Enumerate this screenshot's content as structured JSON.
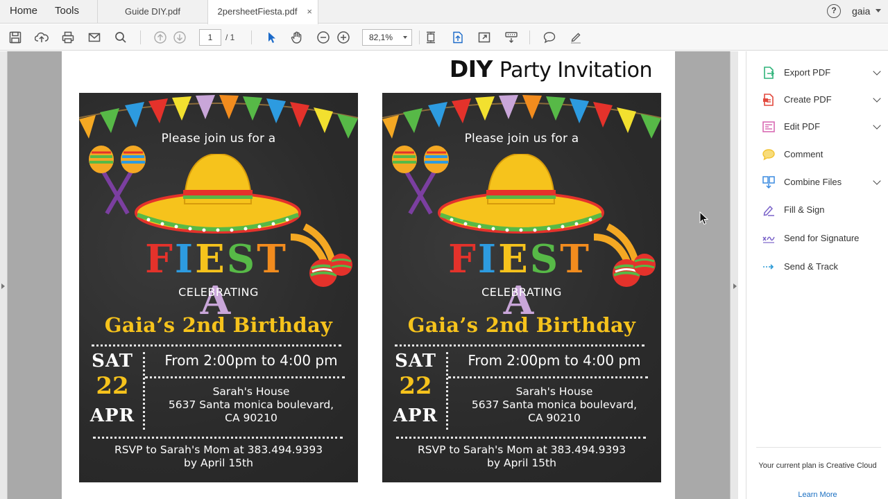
{
  "tabbar": {
    "home_label": "Home",
    "tools_label": "Tools",
    "tabs": [
      {
        "label": "Guide DIY.pdf",
        "active": false
      },
      {
        "label": "2persheetFiesta.pdf",
        "active": true,
        "close": "×"
      }
    ],
    "help_label": "?",
    "user_name": "gaia"
  },
  "toolbar": {
    "page_current": "1",
    "page_total": "/ 1",
    "zoom_value": "82,1%",
    "icons": [
      "save-icon",
      "upload-icon",
      "print-icon",
      "email-icon",
      "search-icon",
      "page-up-icon",
      "page-down-icon",
      "select-cursor-icon",
      "hand-tool-icon",
      "zoom-out-icon",
      "zoom-in-icon",
      "fit-page-icon",
      "scrolling-mode-icon",
      "full-screen-icon",
      "keyboard-tool-icon",
      "comment-icon",
      "sign-icon"
    ]
  },
  "document": {
    "heading_bold": "DIY",
    "heading_rest": "Party Invitation",
    "invitation": {
      "join": "Please join us for a",
      "fiesta_letters": [
        "F",
        "I",
        "E",
        "S",
        "T",
        "A"
      ],
      "fiesta_colors": [
        "#e4322b",
        "#2d9be0",
        "#f6c31c",
        "#57b947",
        "#f28c1e",
        "#c9a6d9"
      ],
      "celebrating": "CELEBRATING",
      "title": "Gaia’s 2nd Birthday",
      "day_of_week": "SAT",
      "day": "22",
      "month": "APR",
      "time": "From 2:00pm to 4:00 pm",
      "address_line1": "Sarah's House",
      "address_line2": "5637 Santa monica boulevard,",
      "address_line3": "CA 90210",
      "rsvp_line1": "RSVP to Sarah's Mom at 383.494.9393",
      "rsvp_line2": "by April 15th"
    }
  },
  "right_panel": {
    "tools": [
      {
        "label": "Export PDF",
        "icon": "export-pdf-icon",
        "color": "#2fb37a",
        "has_chevron": true
      },
      {
        "label": "Create PDF",
        "icon": "create-pdf-icon",
        "color": "#e2493d",
        "has_chevron": true
      },
      {
        "label": "Edit PDF",
        "icon": "edit-pdf-icon",
        "color": "#d86ab3",
        "has_chevron": true
      },
      {
        "label": "Comment",
        "icon": "comment-icon",
        "color": "#f2c230",
        "has_chevron": false
      },
      {
        "label": "Combine Files",
        "icon": "combine-files-icon",
        "color": "#3c8be0",
        "has_chevron": true
      },
      {
        "label": "Fill & Sign",
        "icon": "fill-sign-icon",
        "color": "#7a63c9",
        "has_chevron": false
      },
      {
        "label": "Send for Signature",
        "icon": "send-signature-icon",
        "color": "#7a63c9",
        "has_chevron": false
      },
      {
        "label": "Send & Track",
        "icon": "send-track-icon",
        "color": "#2a9ad6",
        "has_chevron": false
      }
    ],
    "plan_text": "Your current plan is Creative Cloud",
    "learn_more": "Learn More"
  }
}
